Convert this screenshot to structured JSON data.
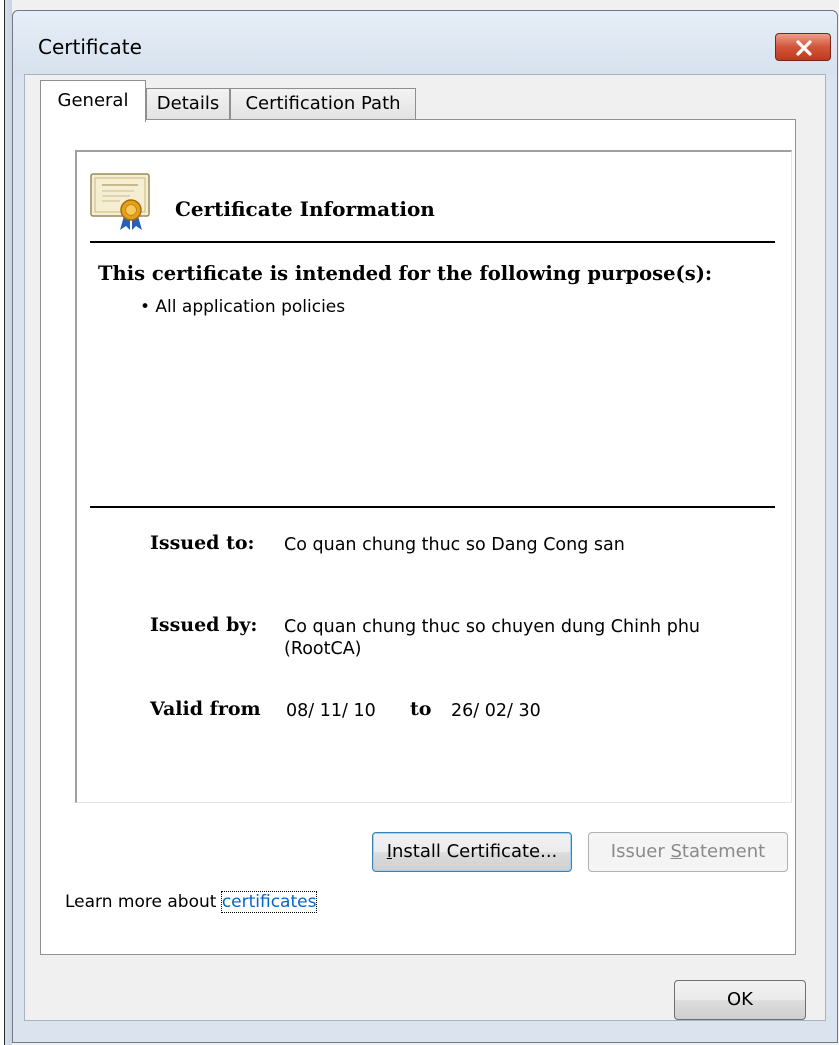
{
  "window": {
    "title": "Certificate"
  },
  "tabs": [
    {
      "label": "General",
      "active": true
    },
    {
      "label": "Details",
      "active": false
    },
    {
      "label": "Certification Path",
      "active": false
    }
  ],
  "info": {
    "heading": "Certificate Information",
    "icon": "certificate-icon",
    "purpose_heading": "This certificate is intended for the following purpose(s):",
    "purposes": [
      "• All application policies"
    ],
    "issued_to_label": "Issued to:",
    "issued_to": "Co quan chung thuc so Dang Cong san",
    "issued_by_label": "Issued by:",
    "issued_by_line1": "Co quan chung thuc so chuyen dung Chinh phu",
    "issued_by_line2": "(RootCA)",
    "valid_from_label": "Valid from",
    "valid_from": "08/ 11/ 10",
    "to_label": "to",
    "valid_to": "26/ 02/ 30"
  },
  "buttons": {
    "install": "Install Certificate...",
    "install_access_key": "I",
    "install_rest": "nstall Certificate...",
    "issuer_statement_pre": "Issuer ",
    "issuer_statement_key": "S",
    "issuer_statement_post": "tatement",
    "ok": "OK"
  },
  "learn_more": {
    "text": "Learn more about ",
    "link": "certificates"
  },
  "colors": {
    "close_button": "#c7432a",
    "link": "#0066cc",
    "title_bar": "#dbe4ee"
  }
}
